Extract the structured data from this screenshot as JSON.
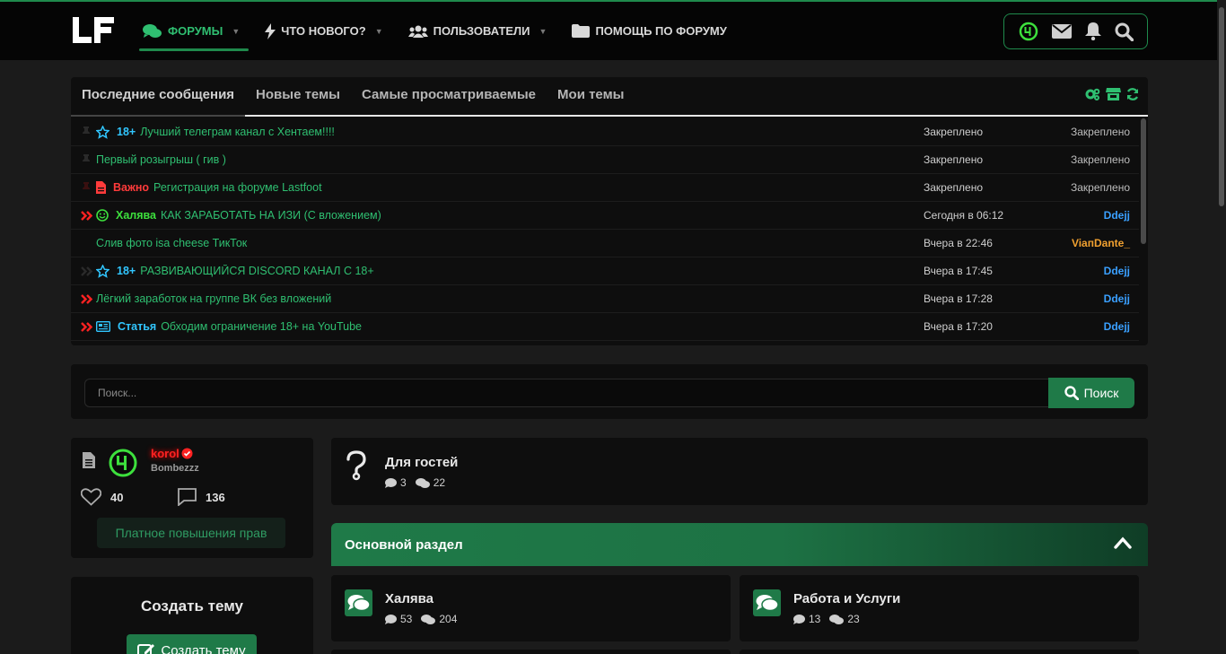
{
  "nav": {
    "logo_text": "LF",
    "items": [
      {
        "label": "ФОРУМЫ",
        "active": true
      },
      {
        "label": "ЧТО НОВОГО?",
        "active": false
      },
      {
        "label": "ПОЛЬЗОВАТЕЛИ",
        "active": false
      },
      {
        "label": "ПОМОЩЬ ПО ФОРУМУ",
        "active": false
      }
    ]
  },
  "tabs": {
    "items": [
      "Последние сообщения",
      "Новые темы",
      "Самые просматриваемые",
      "Мои темы"
    ]
  },
  "threads": [
    {
      "mark": "pin",
      "prefix": "18+",
      "prefix_color": "#31c6ff",
      "prefix_icon": "star-icon",
      "title": "Лучший телеграм канал с Хентаем!!!!",
      "date": "Закреплено",
      "user": "Закреплено"
    },
    {
      "mark": "pin",
      "prefix": "",
      "prefix_color": "",
      "prefix_icon": "",
      "title": "Первый розыгрыш ( гив )",
      "date": "Закреплено",
      "user": "Закреплено"
    },
    {
      "mark": "pin-red",
      "prefix": "Важно",
      "prefix_color": "#ff3b3b",
      "prefix_icon": "document-icon",
      "title": "Регистрация на форуме Lastfoot",
      "date": "Закреплено",
      "user": "Закреплено"
    },
    {
      "mark": "hot",
      "prefix": "Халява",
      "prefix_color": "#3de03d",
      "prefix_icon": "smile-icon",
      "title": "КАК ЗАРАБОТАТЬ НА ИЗИ (С вложением)",
      "date": "Сегодня в 06:12",
      "user": "Ddejj"
    },
    {
      "mark": "none",
      "prefix": "",
      "prefix_color": "",
      "prefix_icon": "",
      "title": "Слив фото isa cheese ТикТок",
      "date": "Вчера в 22:46",
      "user": "ViaпDante_"
    },
    {
      "mark": "hot-dark",
      "prefix": "18+",
      "prefix_color": "#31c6ff",
      "prefix_icon": "star-icon",
      "title": "РАЗВИВАЮЩИЙСЯ DISCORD КАНАЛ С 18+",
      "date": "Вчера в 17:45",
      "user": "Ddejj"
    },
    {
      "mark": "hot",
      "prefix": "",
      "prefix_color": "",
      "prefix_icon": "",
      "title": "Лёгкий заработок на группе ВК без вложений",
      "date": "Вчера в 17:28",
      "user": "Ddejj"
    },
    {
      "mark": "hot",
      "prefix": "Статья",
      "prefix_color": "#31c6ff",
      "prefix_icon": "newspaper-icon",
      "title": "Обходим ограничение 18+ на YouTube",
      "date": "Вчера в 17:20",
      "user": "Ddejj"
    }
  ],
  "search": {
    "placeholder": "Поиск...",
    "button_label": "Поиск"
  },
  "profile": {
    "username": "korol",
    "user_title": "Bombezzz",
    "likes": "40",
    "messages": "136",
    "upgrade_label": "Платное повышения прав"
  },
  "create": {
    "title": "Создать тему",
    "button_label": "Создать тему"
  },
  "guest_forum": {
    "title": "Для гостей",
    "threads": "3",
    "messages": "22"
  },
  "section": {
    "title": "Основной раздел"
  },
  "nodes": [
    {
      "title": "Халява",
      "threads": "53",
      "messages": "204"
    },
    {
      "title": "Работа и Услуги",
      "threads": "13",
      "messages": "23"
    }
  ],
  "colors": {
    "accent": "#1f7a48",
    "accent_text": "#2fbf71",
    "background": "#1b1b1b",
    "panel": "#0e0e0e"
  }
}
